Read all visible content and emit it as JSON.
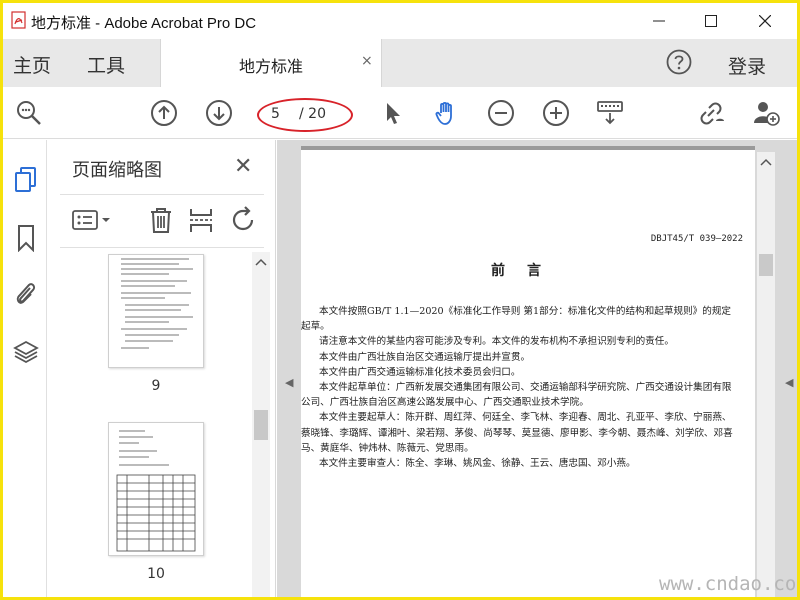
{
  "window": {
    "title": "地方标准 - Adobe Acrobat Pro DC",
    "minimize_glyph": "—",
    "maximize_glyph": "☐",
    "close_glyph": "✕"
  },
  "tabs": {
    "home": "主页",
    "tools": "工具",
    "document": "地方标准",
    "document_close": "×",
    "login": "登录"
  },
  "toolbar": {
    "current_page": "5",
    "total_pages": "/ 20"
  },
  "thumbnail_panel": {
    "title": "页面缩略图",
    "close": "✕",
    "pages": [
      {
        "label": "9"
      },
      {
        "label": "10"
      }
    ]
  },
  "document": {
    "code": "DBJT45/T 039—2022",
    "heading": "前言",
    "lines": [
      {
        "text": "本文件按照GB/T 1.1—2020《标准化工作导则  第1部分：标准化文件的结构和起草规则》的规定",
        "indent": true
      },
      {
        "text": "起草。",
        "indent": false
      },
      {
        "text": "请注意本文件的某些内容可能涉及专利。本文件的发布机构不承担识别专利的责任。",
        "indent": true
      },
      {
        "text": "本文件由广西壮族自治区交通运输厅提出并宣贯。",
        "indent": true
      },
      {
        "text": "本文件由广西交通运输标准化技术委员会归口。",
        "indent": true
      },
      {
        "text": "本文件起草单位：广西新发展交通集团有限公司、交通运输部科学研究院、广西交通设计集团有限",
        "indent": true
      },
      {
        "text": "公司、广西壮族自治区高速公路发展中心、广西交通职业技术学院。",
        "indent": false
      },
      {
        "text": "本文件主要起草人：陈开群、周红萍、何廷全、李飞林、李迎春、周北、孔亚平、李欣、宁丽燕、",
        "indent": true
      },
      {
        "text": "蔡晓锋、李璐辉、谭湘叶、梁若翔、茅俊、尚琴琴、莫显德、廖甲影、李今朝、聂杰峰、刘学欣、邓喜",
        "indent": false
      },
      {
        "text": "马、黄庭华、钟炜林、陈薇元、党思雨。",
        "indent": false
      },
      {
        "text": "本文件主要审查人：陈全、李琳、姚风金、徐静、王云、唐忠国、邓小燕。",
        "indent": true
      }
    ]
  },
  "watermark": "www.cndao.com",
  "colors": {
    "frame": "#f6e20c",
    "accent_blue": "#2d6fd6",
    "annotation_red": "#d8232a"
  }
}
